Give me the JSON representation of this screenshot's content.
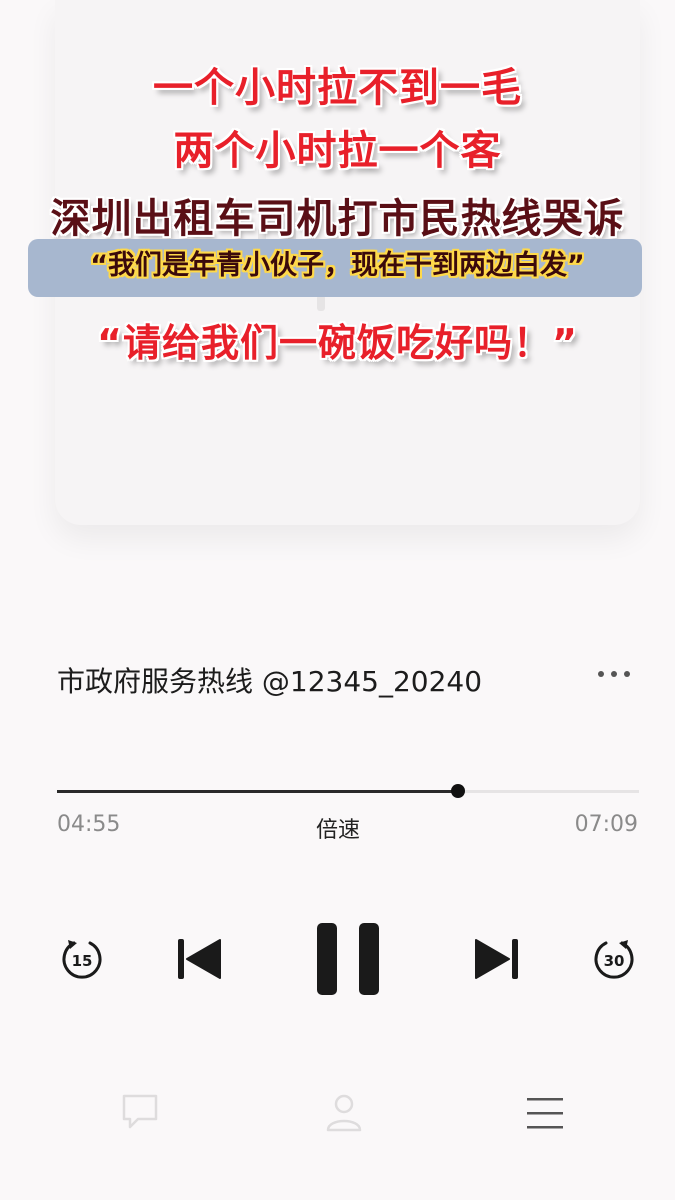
{
  "headline": {
    "line1": "一个小时拉不到一毛",
    "line2": "两个小时拉一个客",
    "line3": "深圳出租车司机打市民热线哭诉",
    "quote1": "“我们是年青小伙子，现在干到两边白发”",
    "quote2": "“请给我们一碗饭吃好吗！”"
  },
  "track": {
    "title": "市政府服务热线 @12345_20240"
  },
  "player": {
    "elapsed": "04:55",
    "duration": "07:09",
    "speed_label": "倍速",
    "progress": 0.689,
    "rewind_seconds": "15",
    "forward_seconds": "30"
  },
  "icons": {
    "more": "more-dots-icon",
    "rewind": "rewind-15-icon",
    "previous": "skip-previous-icon",
    "pause": "pause-icon",
    "next": "skip-next-icon",
    "forward": "forward-30-icon",
    "comment": "comment-icon",
    "profile": "profile-icon",
    "menu": "menu-icon"
  },
  "colors": {
    "headline_red": "#e8202a",
    "headline_dark": "#5a0f16",
    "quote_band": "#a7b7cf",
    "quote_outline": "#ffd94a",
    "background": "#faf8f9"
  }
}
